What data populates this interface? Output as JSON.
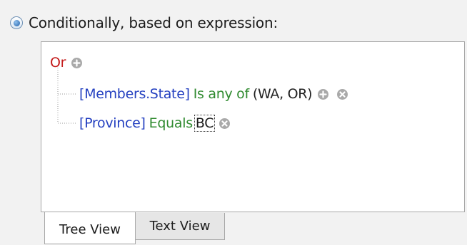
{
  "condition_option": {
    "label": "Conditionally, based on expression:",
    "selected": true
  },
  "expression_tree": {
    "root_operator": "Or",
    "conditions": [
      {
        "field": "[Members.State]",
        "operator": "Is any of",
        "value": "(WA, OR)"
      },
      {
        "field": "[Province]",
        "operator": "Equals",
        "value": "BC"
      }
    ]
  },
  "tabs": [
    {
      "label": "Tree View",
      "active": true
    },
    {
      "label": "Text View",
      "active": false
    }
  ],
  "colors": {
    "operator_or": "#c41a1a",
    "field": "#2440c0",
    "operator": "#2f8a2f",
    "icon": "#a9a9a9"
  },
  "icons": {
    "add": "plus-circle-icon",
    "remove": "x-circle-icon"
  }
}
